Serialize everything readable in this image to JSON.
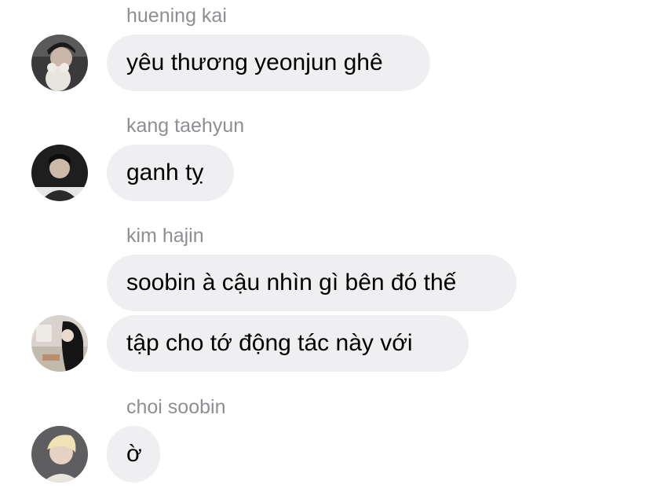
{
  "messages": [
    {
      "sender": "huening kai",
      "avatar_icon": "user-avatar-icon",
      "bubbles": [
        "yêu thương yeonjun ghê"
      ]
    },
    {
      "sender": "kang taehyun",
      "avatar_icon": "user-avatar-icon",
      "bubbles": [
        "ganh tỵ"
      ]
    },
    {
      "sender": "kim hajin",
      "avatar_icon": "user-avatar-icon",
      "bubbles": [
        "soobin à cậu nhìn gì bên đó thế",
        "tập cho tớ động tác này với"
      ]
    },
    {
      "sender": "choi soobin",
      "avatar_icon": "user-avatar-icon",
      "bubbles": [
        "ờ"
      ]
    }
  ],
  "colors": {
    "bubble_bg": "#efeff1",
    "sender_text": "#8e8e93",
    "message_text": "#000000"
  }
}
